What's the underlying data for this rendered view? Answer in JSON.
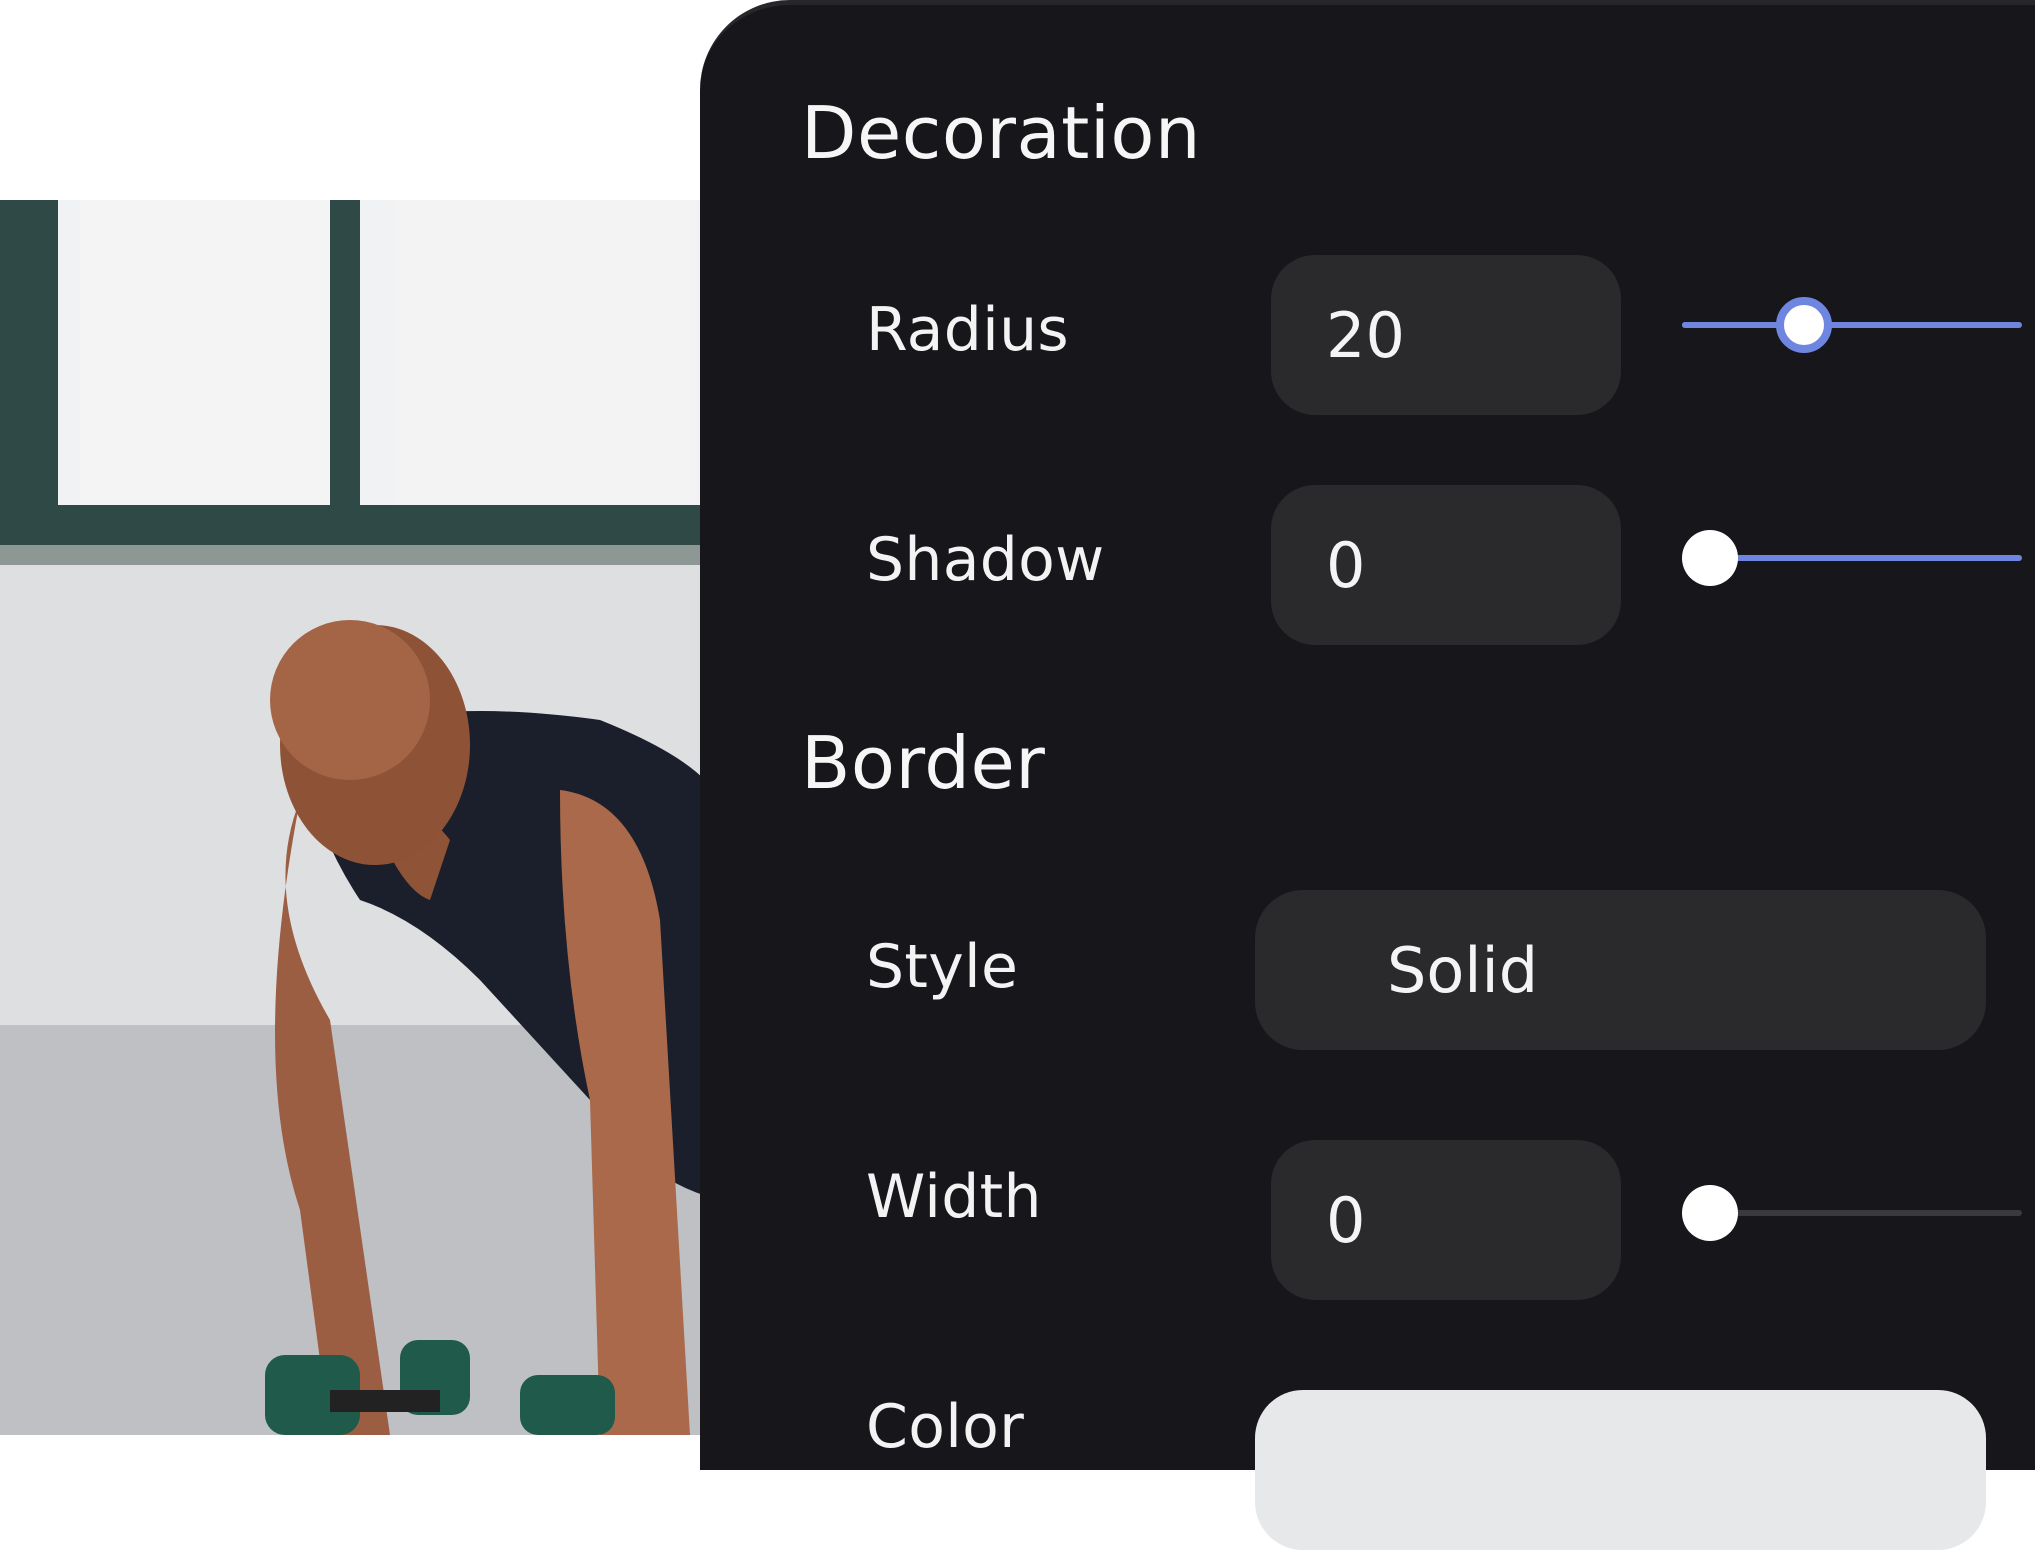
{
  "colors": {
    "panel_bg": "#17171b",
    "field_bg": "#2a2a2c",
    "accent": "#6f86e0",
    "track_inactive": "#3a3a3e",
    "color_swatch": "#e6e8ea"
  },
  "decoration": {
    "title": "Decoration",
    "radius": {
      "label": "Radius",
      "value": "20",
      "slider_fraction": 0.36,
      "active": true
    },
    "shadow": {
      "label": "Shadow",
      "value": "0",
      "slider_fraction": 0.0,
      "active": true
    }
  },
  "border": {
    "title": "Border",
    "style": {
      "label": "Style",
      "value": "Solid"
    },
    "width": {
      "label": "Width",
      "value": "0",
      "slider_fraction": 0.0,
      "active": false
    },
    "color": {
      "label": "Color"
    }
  },
  "photo": {
    "icon": "fitness-photo"
  }
}
